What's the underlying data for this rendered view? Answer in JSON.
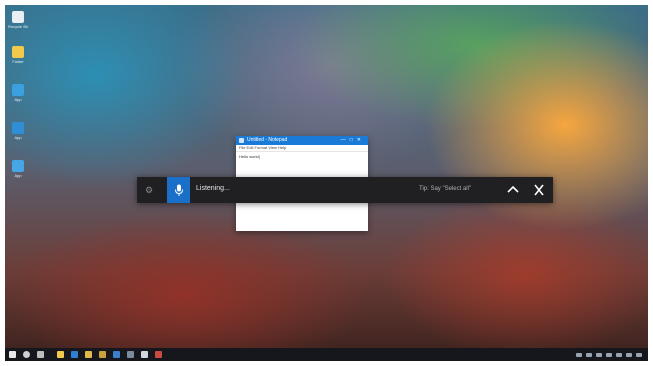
{
  "desktop": {
    "icons": [
      {
        "name": "recycle-bin-icon",
        "label": "Recycle Bin",
        "color": "#e9eef3"
      },
      {
        "name": "folder-icon",
        "label": "Folder",
        "color": "#f2c94c"
      },
      {
        "name": "app-icon-blue-1",
        "label": "App",
        "color": "#3aa0e0"
      },
      {
        "name": "app-icon-blue-2",
        "label": "App",
        "color": "#2f8fd6"
      },
      {
        "name": "app-icon-blue-3",
        "label": "App",
        "color": "#46a6e6"
      }
    ]
  },
  "notepad": {
    "title": "Untitled - Notepad",
    "menu": "File  Edit  Format  View  Help",
    "body_text": "Hello world|"
  },
  "dictation": {
    "settings_icon": "gear-icon",
    "mic_icon": "microphone-icon",
    "status": "Listening...",
    "hint": "Tip: Say \"Select all\"",
    "collapse_icon": "chevron-up-icon",
    "close_icon": "close-icon",
    "accent_color": "#1a6fc9"
  },
  "taskbar": {
    "left_items": [
      {
        "name": "start-button",
        "color": "#e8e8e8"
      },
      {
        "name": "search-icon",
        "color": "#cfcfcf"
      },
      {
        "name": "task-view-icon",
        "color": "#bdbdbd"
      },
      {
        "name": "file-explorer-icon",
        "color": "#f2c94c"
      },
      {
        "name": "edge-icon",
        "color": "#2f7fd6"
      },
      {
        "name": "store-icon",
        "color": "#e0b84c"
      },
      {
        "name": "mail-icon",
        "color": "#c9a23e"
      },
      {
        "name": "app-icon-1",
        "color": "#3a7fcf"
      },
      {
        "name": "app-icon-2",
        "color": "#7c8aa0"
      },
      {
        "name": "app-icon-3",
        "color": "#d0d6de"
      },
      {
        "name": "app-icon-4",
        "color": "#c94a3e"
      }
    ]
  }
}
